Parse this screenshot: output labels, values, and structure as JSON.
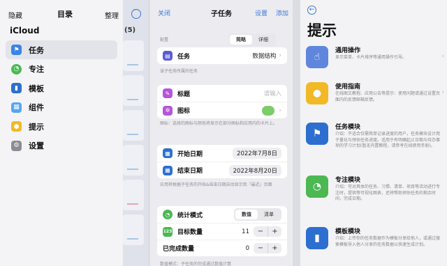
{
  "panel1": {
    "nav_left": "隐藏",
    "nav_title": "目录",
    "nav_right": "整理",
    "bg_count": "(5)",
    "section_title": "iCloud",
    "menu": [
      {
        "label": "任务",
        "color": "#3b82e6",
        "icon": "flag-icon"
      },
      {
        "label": "专注",
        "color": "#4bb852",
        "icon": "clock-icon"
      },
      {
        "label": "模板",
        "color": "#2d6fd0",
        "icon": "bookmark-icon"
      },
      {
        "label": "组件",
        "color": "#57a5f2",
        "icon": "widgets-icon"
      },
      {
        "label": "提示",
        "color": "#f2b926",
        "icon": "lightbulb-icon"
      },
      {
        "label": "设置",
        "color": "#8c8c94",
        "icon": "gear-icon"
      }
    ]
  },
  "panel2": {
    "nav_left": "关闭",
    "nav_title": "子任务",
    "nav_set": "设置",
    "nav_add": "添加",
    "config_label": "配置",
    "seg_simple": "简略",
    "seg_detail": "详细",
    "task_label": "任务",
    "task_value": "数据结构",
    "task_note": "该子任务所属的任务",
    "title_label": "标题",
    "title_placeholder": "请输入",
    "icon_label": "图标",
    "icon_note": "图标：选择的图标与颜色将显示在部分图标和应用内的卡片上。",
    "start_label": "开始日期",
    "start_value": "2022年7月8日",
    "end_label": "结束日期",
    "end_value": "2022年8月20日",
    "date_note": "应用将根据子任务的开始&结束日期自动显示到『最近』页面",
    "stat_label": "统计模式",
    "stat_count": "数值",
    "stat_list": "清单",
    "target_label": "目标数量",
    "target_value": "11",
    "done_label": "已完成数量",
    "done_value": "0",
    "minus": "−",
    "plus": "+",
    "bottom_note": "数值模式：子任务的完成通过数值计算"
  },
  "panel3": {
    "title": "提示",
    "tips": [
      {
        "title": "通用操作",
        "desc": "显示菜单、卡片排序等通用操作引导。",
        "color": "#5f86dc",
        "icon": "tap-icon"
      },
      {
        "title": "使用指南",
        "desc": "在线图文教程、应用公告等提示：使用问题请通过设置页面内的反馈邮箱反馈。",
        "color": "#f2b926",
        "icon": "lightbulb-icon"
      },
      {
        "title": "任务模块",
        "desc": "介绍：不适合仅需简单记录进度的用户，任务模块设计用于量化与预估任务进度。适用于有明确起止日期与待办事项的学习计划(暂无内置教程，请参考在线使用手册)。",
        "color": "#2d6fd0",
        "icon": "flag-icon"
      },
      {
        "title": "专注模块",
        "desc": "介绍：可对具体的任务、习惯、清单、项目等活动进行专注时，提供等可视化图表，还将帮助预估任务的剩余时间，完成日期。",
        "color": "#4bb852",
        "icon": "clock-icon"
      },
      {
        "title": "模板模块",
        "desc": "介绍：上传你的任务数据作为模板分享给他人，或通过搜索模板导入他人分享的任务数据以快速生成计划。",
        "color": "#2d6fd0",
        "icon": "bookmark-icon"
      }
    ]
  }
}
